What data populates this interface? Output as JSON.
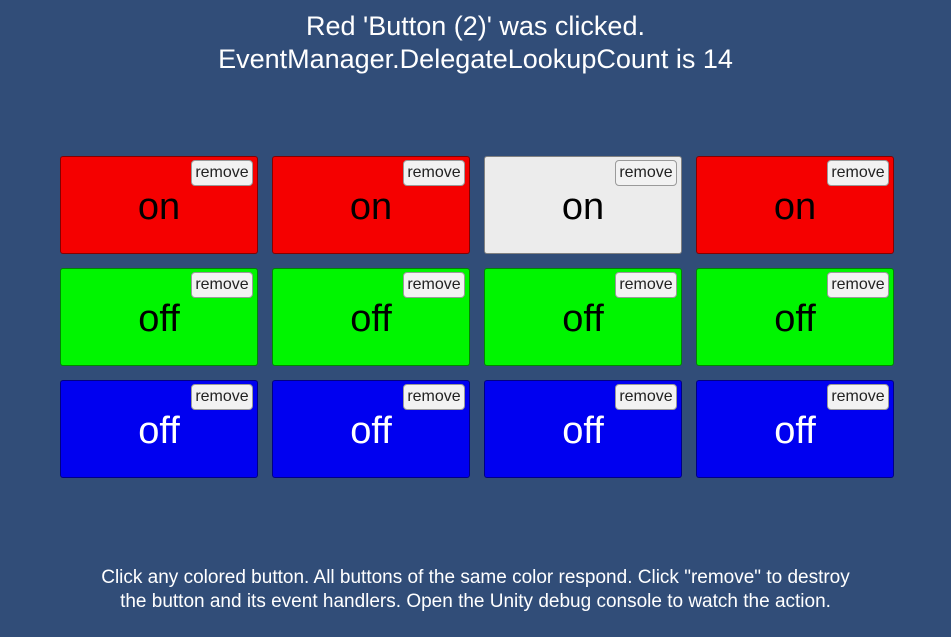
{
  "status": {
    "line1": "Red 'Button (2)' was clicked.",
    "line2": "EventManager.DelegateLookupCount is 14"
  },
  "colors": {
    "background": "#314d78",
    "red": "#f50000",
    "green": "#00f500",
    "blue": "#0000f0",
    "highlighted": "#ececec",
    "text_dark": "#000000",
    "text_light": "#ffffff"
  },
  "remove_label": "remove",
  "rows": [
    {
      "color": "red",
      "buttons": [
        {
          "state": "on",
          "fill": "#f50000",
          "text_color": "#000000"
        },
        {
          "state": "on",
          "fill": "#f50000",
          "text_color": "#000000"
        },
        {
          "state": "on",
          "fill": "#ececec",
          "text_color": "#000000"
        },
        {
          "state": "on",
          "fill": "#f50000",
          "text_color": "#000000"
        }
      ]
    },
    {
      "color": "green",
      "buttons": [
        {
          "state": "off",
          "fill": "#00f500",
          "text_color": "#000000"
        },
        {
          "state": "off",
          "fill": "#00f500",
          "text_color": "#000000"
        },
        {
          "state": "off",
          "fill": "#00f500",
          "text_color": "#000000"
        },
        {
          "state": "off",
          "fill": "#00f500",
          "text_color": "#000000"
        }
      ]
    },
    {
      "color": "blue",
      "buttons": [
        {
          "state": "off",
          "fill": "#0000f0",
          "text_color": "#ffffff"
        },
        {
          "state": "off",
          "fill": "#0000f0",
          "text_color": "#ffffff"
        },
        {
          "state": "off",
          "fill": "#0000f0",
          "text_color": "#ffffff"
        },
        {
          "state": "off",
          "fill": "#0000f0",
          "text_color": "#ffffff"
        }
      ]
    }
  ],
  "footer": {
    "line1": "Click any colored button. All buttons of the same color respond. Click \"remove\" to destroy",
    "line2": "the button and its event handlers. Open the Unity debug console to watch the action."
  }
}
